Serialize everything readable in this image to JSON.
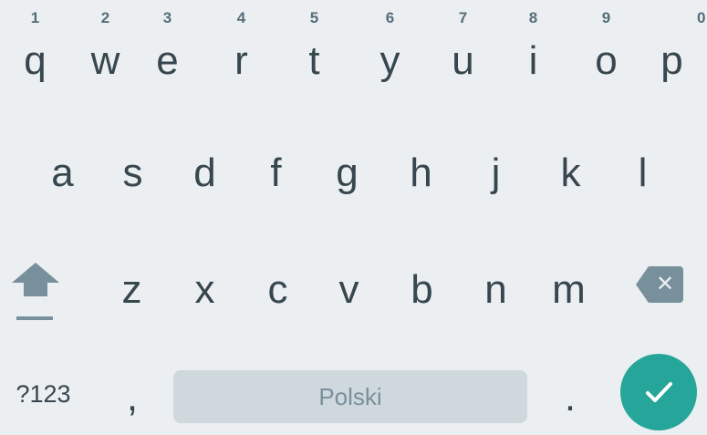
{
  "keyboard": {
    "row1": [
      {
        "letter": "q",
        "hint": "1"
      },
      {
        "letter": "w",
        "hint": "2"
      },
      {
        "letter": "e",
        "hint": "3"
      },
      {
        "letter": "r",
        "hint": "4"
      },
      {
        "letter": "t",
        "hint": "5"
      },
      {
        "letter": "y",
        "hint": "6"
      },
      {
        "letter": "u",
        "hint": "7"
      },
      {
        "letter": "i",
        "hint": "8"
      },
      {
        "letter": "o",
        "hint": "9"
      },
      {
        "letter": "p",
        "hint": "0"
      }
    ],
    "row2": [
      "a",
      "s",
      "d",
      "f",
      "g",
      "h",
      "j",
      "k",
      "l"
    ],
    "row3": [
      "z",
      "x",
      "c",
      "v",
      "b",
      "n",
      "m"
    ],
    "symbols_label": "?123",
    "comma_label": ",",
    "space_label": "Polski",
    "period_label": ".",
    "colors": {
      "background": "#eceff1",
      "key_text": "#37474f",
      "icon": "#78909c",
      "space_bar": "#cfd8dc",
      "enter": "#26a69a"
    },
    "icons": {
      "shift": "shift-icon",
      "backspace": "backspace-icon",
      "enter": "checkmark-icon"
    }
  }
}
